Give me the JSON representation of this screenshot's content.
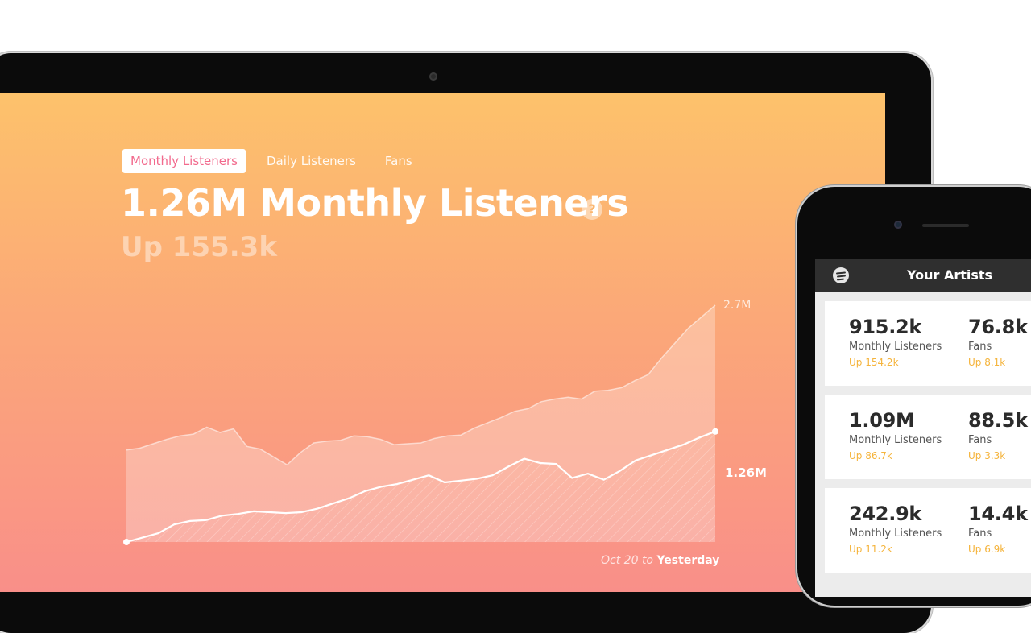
{
  "dashboard": {
    "tabs": [
      "Monthly Listeners",
      "Daily Listeners",
      "Fans"
    ],
    "active_tab": "Monthly Listeners",
    "headline": "1.26M Monthly Listeners",
    "help_symbol": "?",
    "change": "Up 155.3k",
    "range_from": "Oct 20",
    "range_to_word": "to",
    "range_to": "Yesterday",
    "top_label": "2.7M",
    "current_label": "1.26M"
  },
  "chart_data": {
    "type": "area",
    "title": "",
    "xlabel": "",
    "ylabel": "",
    "ylim": [
      0,
      2.7
    ],
    "y_units": "M",
    "series": [
      {
        "values": [
          1.05,
          1.07,
          1.12,
          1.17,
          1.21,
          1.23,
          1.31,
          1.25,
          1.29,
          1.09,
          1.06,
          0.97,
          0.88,
          1.02,
          1.13,
          1.15,
          1.16,
          1.21,
          1.2,
          1.17,
          1.11,
          1.12,
          1.13,
          1.18,
          1.21,
          1.22,
          1.3,
          1.36,
          1.42,
          1.49,
          1.52,
          1.6,
          1.63,
          1.65,
          1.63,
          1.72,
          1.73,
          1.76,
          1.84,
          1.91,
          2.1,
          2.27,
          2.44,
          2.57,
          2.7
        ]
      },
      {
        "values": [
          0.0,
          0.05,
          0.1,
          0.2,
          0.24,
          0.25,
          0.3,
          0.32,
          0.35,
          0.34,
          0.33,
          0.34,
          0.38,
          0.44,
          0.5,
          0.58,
          0.63,
          0.66,
          0.71,
          0.76,
          0.68,
          0.7,
          0.72,
          0.76,
          0.86,
          0.95,
          0.9,
          0.89,
          0.73,
          0.78,
          0.71,
          0.81,
          0.93,
          0.99,
          1.05,
          1.11,
          1.19,
          1.26
        ]
      }
    ],
    "end_label": "1.26M",
    "legend": "none",
    "grid": false
  },
  "phone": {
    "title": "Your Artists",
    "cards": [
      {
        "listeners": "915.2k",
        "listeners_label": "Monthly Listeners",
        "listeners_change": "Up 154.2k",
        "fans": "76.8k",
        "fans_label": "Fans",
        "fans_change": "Up 8.1k"
      },
      {
        "listeners": "1.09M",
        "listeners_label": "Monthly Listeners",
        "listeners_change": "Up 86.7k",
        "fans": "88.5k",
        "fans_label": "Fans",
        "fans_change": "Up 3.3k"
      },
      {
        "listeners": "242.9k",
        "listeners_label": "Monthly Listeners",
        "listeners_change": "Up 11.2k",
        "fans": "14.4k",
        "fans_label": "Fans",
        "fans_change": "Up 6.9k"
      }
    ]
  }
}
